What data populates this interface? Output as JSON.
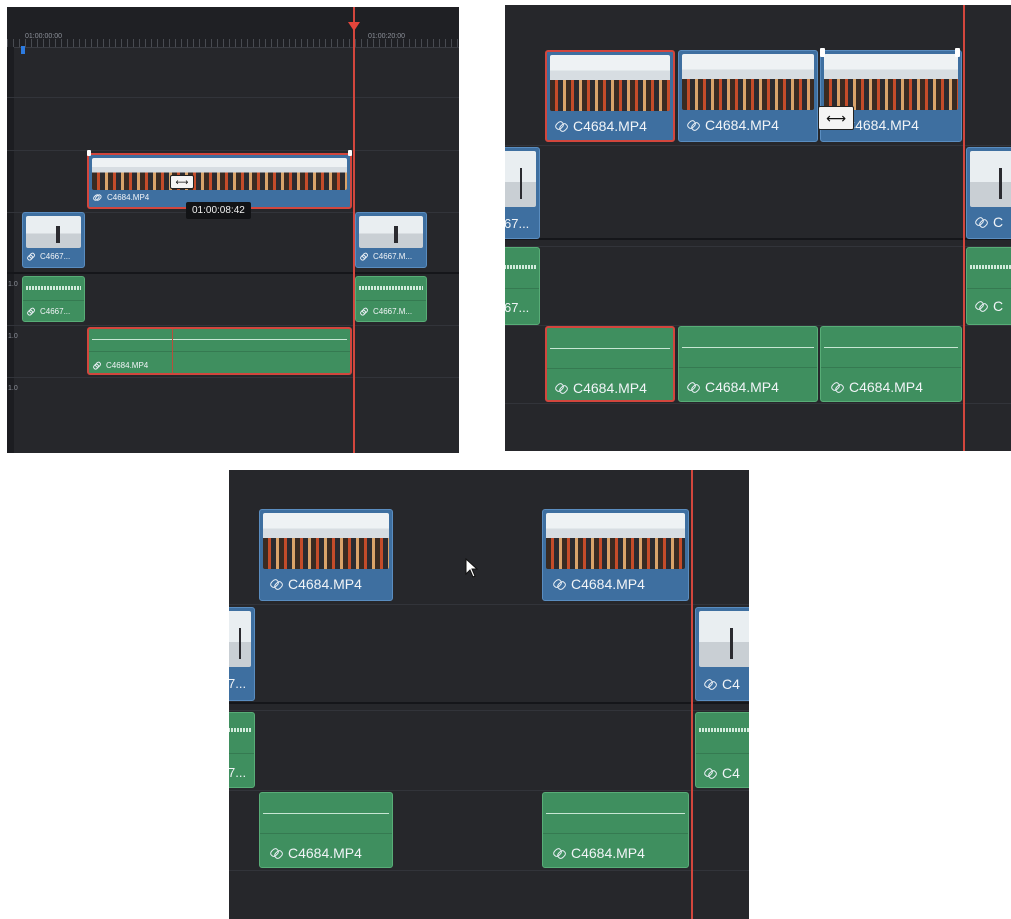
{
  "panel_a": {
    "ruler": {
      "timecode_start": "01:00:00:00",
      "timecode_end": "01:00:20:00"
    },
    "track_labels": [
      "1.0",
      "1.0",
      "1.0"
    ],
    "tooltip": "01:00:08:42",
    "clips": {
      "main_video": "C4684.MP4",
      "left_video": "C4667...",
      "right_video": "C4667.M...",
      "left_audio": "C4667...",
      "right_audio": "C4667.M...",
      "main_audio": "C4684.MP4"
    }
  },
  "panel_b": {
    "clips": {
      "video_1": "C4684.MP4",
      "video_2": "C4684.MP4",
      "video_3": "C4684.MP4",
      "left_partial_video": "67...",
      "left_partial_audio": "67...",
      "right_partial_video": "C",
      "right_partial_audio": "C",
      "audio_1": "C4684.MP4",
      "audio_2": "C4684.MP4",
      "audio_3": "C4684.MP4"
    }
  },
  "panel_c": {
    "clips": {
      "video_1": "C4684.MP4",
      "video_2": "C4684.MP4",
      "left_partial_video": "7...",
      "left_partial_audio": "7...",
      "right_partial_video": "C4",
      "right_partial_audio": "C4",
      "audio_1": "C4684.MP4",
      "audio_2": "C4684.MP4"
    }
  },
  "icons": {
    "link": "link-icon",
    "blade": "razor-blade-icon",
    "trim": "trim-handle-icon",
    "cursor": "mouse-pointer-icon",
    "playhead": "playhead-marker-icon"
  },
  "colors": {
    "timeline_bg": "#26272b",
    "video_clip": "#3e6fa0",
    "audio_clip": "#3f8f5f",
    "selection": "#d2463d",
    "playhead": "#d2463d"
  }
}
